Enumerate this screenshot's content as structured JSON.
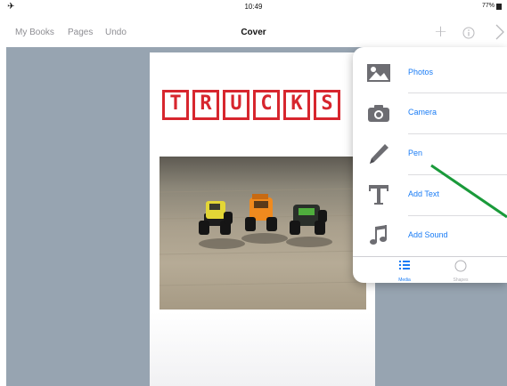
{
  "status_bar": {
    "time": "10:49",
    "battery": "77%"
  },
  "nav": {
    "my_books": "My Books",
    "pages": "Pages",
    "undo": "Undo",
    "title": "Cover"
  },
  "book_page": {
    "title_letters": [
      "T",
      "R",
      "U",
      "C",
      "K",
      "S"
    ]
  },
  "media_menu": {
    "items": [
      {
        "label": "Photos",
        "icon": "photos-icon"
      },
      {
        "label": "Camera",
        "icon": "camera-icon"
      },
      {
        "label": "Pen",
        "icon": "pen-icon"
      },
      {
        "label": "Add Text",
        "icon": "text-icon"
      },
      {
        "label": "Add Sound",
        "icon": "music-note-icon"
      }
    ],
    "tabs": [
      {
        "label": "Media",
        "active": true
      },
      {
        "label": "Shapes",
        "active": false
      }
    ]
  },
  "colors": {
    "accent": "#1a7cf5",
    "title_red": "#d7262e",
    "workspace": "#97a4b1",
    "annotation_arrow": "#1a9a3a"
  }
}
